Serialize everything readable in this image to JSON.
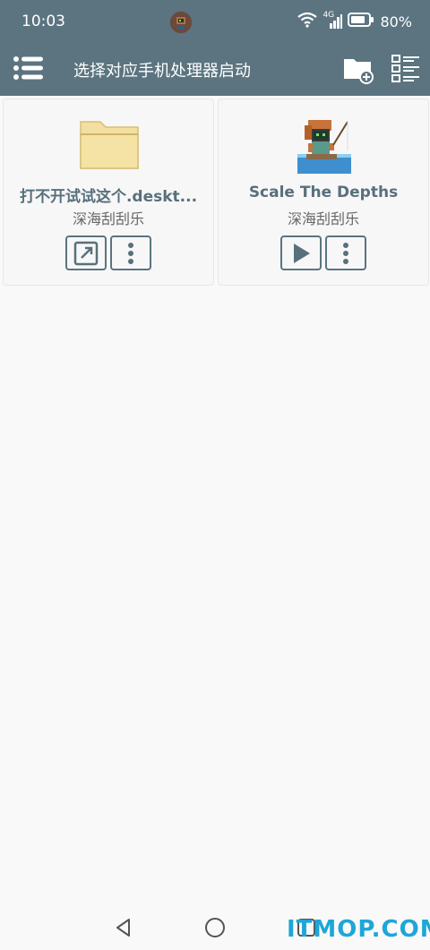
{
  "status_bar": {
    "time": "10:03",
    "network": "4G",
    "battery": "80%",
    "icons": [
      "app-icon",
      "wifi-icon",
      "signal-icon",
      "battery-icon"
    ]
  },
  "app_bar": {
    "title": "选择对应手机处理器启动",
    "icons": [
      "menu-icon",
      "new-folder-icon",
      "view-list-icon"
    ],
    "color": "#5b7480"
  },
  "items": [
    {
      "title": "打不开试试这个.deskt...",
      "subtitle": "深海刮刮乐",
      "icon": "folder-icon",
      "actions": [
        "open-external-icon",
        "more-vert-icon"
      ]
    },
    {
      "title": "Scale The Depths",
      "subtitle": "深海刮刮乐",
      "icon": "game-thumbnail",
      "actions": [
        "play-icon",
        "more-vert-icon"
      ]
    }
  ],
  "nav_bar": {
    "icons": [
      "back-icon",
      "home-icon",
      "recent-apps-icon"
    ]
  },
  "watermark": {
    "text": "ITMOP.COM",
    "color": "#1ea6d8"
  }
}
